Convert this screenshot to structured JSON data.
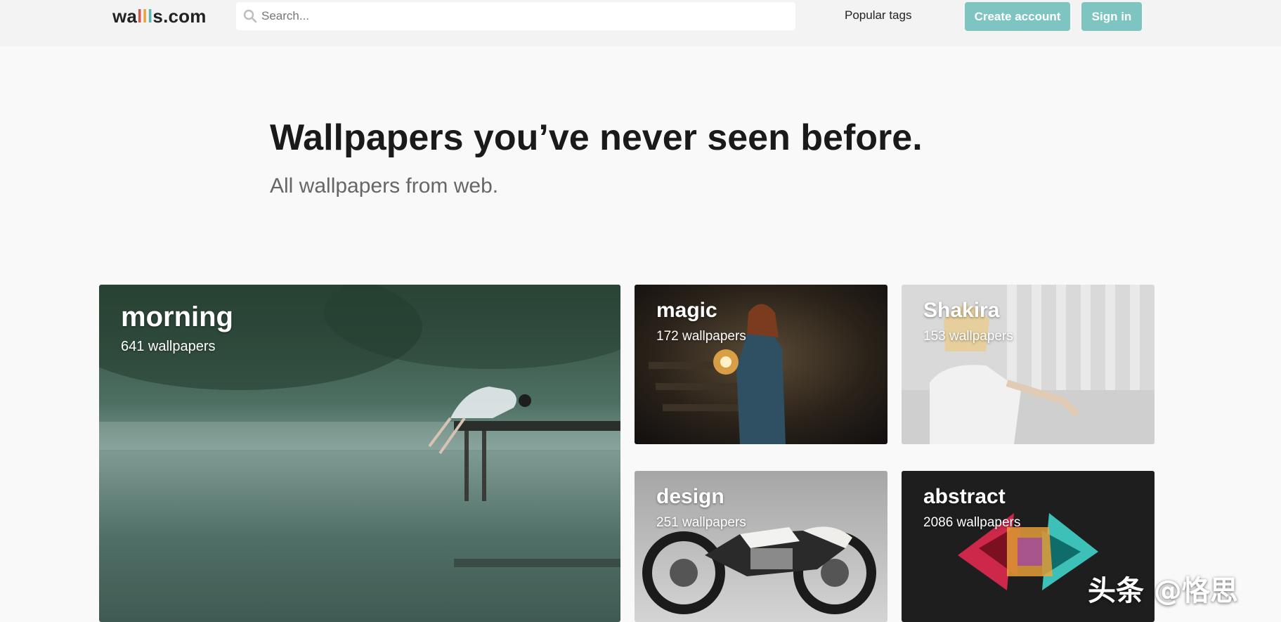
{
  "header": {
    "logo": {
      "prefix": "wa",
      "l1": "l",
      "l2": "l",
      "l3": "l",
      "suffix": "s.com"
    },
    "search": {
      "placeholder": "Search...",
      "value": ""
    },
    "nav_popular": "Popular tags",
    "create_account": "Create account",
    "sign_in": "Sign in"
  },
  "hero": {
    "title": "Wallpapers you’ve never seen before.",
    "subtitle": "All wallpapers from web."
  },
  "tiles": [
    {
      "name": "morning",
      "count": "641 wallpapers",
      "icon": "lake-pier-photo"
    },
    {
      "name": "magic",
      "count": "172 wallpapers",
      "icon": "sorceress-photo"
    },
    {
      "name": "Shakira",
      "count": "153 wallpapers",
      "icon": "portrait-photo"
    },
    {
      "name": "design",
      "count": "251 wallpapers",
      "icon": "motorcycle-photo"
    },
    {
      "name": "abstract",
      "count": "2086 wallpapers",
      "icon": "triangles-photo"
    }
  ],
  "watermark": "头条 @恪思",
  "colors": {
    "accent": "#7ec4c0",
    "header_bg": "#f3f3f3",
    "page_bg": "#f9f9f9"
  }
}
